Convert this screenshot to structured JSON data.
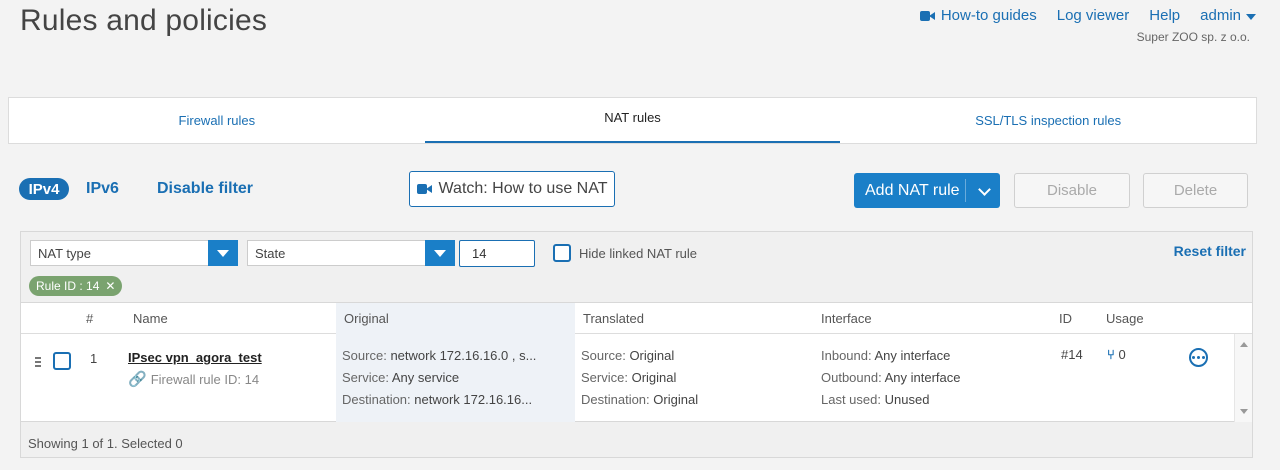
{
  "page": {
    "title": "Rules and policies"
  },
  "top_nav": {
    "how_to": "How-to guides",
    "log_viewer": "Log viewer",
    "help": "Help",
    "user": "admin",
    "org": "Super ZOO sp. z o.o."
  },
  "tabs": [
    {
      "label": "Firewall rules"
    },
    {
      "label": "NAT rules",
      "active": true
    },
    {
      "label": "SSL/TLS inspection rules"
    }
  ],
  "toolbar": {
    "ipv4": "IPv4",
    "ipv6": "IPv6",
    "disable_filter": "Disable filter",
    "watch": "Watch: How to use NAT",
    "add_rule": "Add NAT rule",
    "disable": "Disable",
    "delete": "Delete"
  },
  "filters": {
    "nat_type": "NAT type",
    "state": "State",
    "id_value": "14",
    "hide_linked": "Hide linked NAT rule",
    "reset": "Reset filter",
    "chip": "Rule ID : 14"
  },
  "table": {
    "headers": [
      "#",
      "Name",
      "Original",
      "Translated",
      "Interface",
      "ID",
      "Usage"
    ],
    "rows": [
      {
        "num": "1",
        "name": "IPsec vpn_agora_test",
        "fw_rule": "Firewall rule ID: 14",
        "original": {
          "source_label": "Source:",
          "source": "network 172.16.16.0 , s...",
          "service_label": "Service:",
          "service": "Any service",
          "destination_label": "Destination:",
          "destination": "network 172.16.16..."
        },
        "translated": {
          "source_label": "Source:",
          "source": "Original",
          "service_label": "Service:",
          "service": "Original",
          "destination_label": "Destination:",
          "destination": "Original"
        },
        "interface": {
          "inbound_label": "Inbound:",
          "inbound": "Any interface",
          "outbound_label": "Outbound:",
          "outbound": "Any interface",
          "last_used_label": "Last used:",
          "last_used": "Unused"
        },
        "id": "#14",
        "usage": "0"
      }
    ]
  },
  "footer": {
    "status": "Showing 1 of 1. Selected 0"
  },
  "colors": {
    "accent": "#1a6fb3",
    "button": "#1a7fc8",
    "chip": "#7aa36f",
    "shade": "#eef2f7"
  }
}
